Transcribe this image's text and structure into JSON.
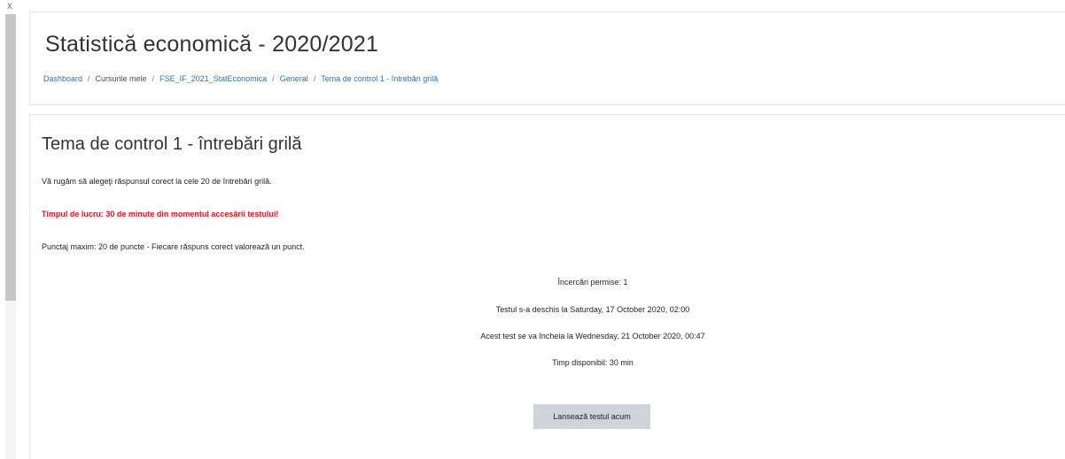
{
  "ui": {
    "collapse_glyph": "x"
  },
  "header": {
    "course_title": "Statistică economică - 2020/2021",
    "breadcrumb": [
      {
        "label": "Dashboard",
        "link": true
      },
      {
        "label": "Cursurile mele",
        "link": false
      },
      {
        "label": "FSE_IF_2021_StatEconomica",
        "link": true
      },
      {
        "label": "General",
        "link": true
      },
      {
        "label": "Tema de control 1 - întrebări grilă",
        "link": true
      }
    ],
    "separator": "/"
  },
  "quiz": {
    "title": "Tema de control 1 - întrebări grilă",
    "intro": [
      "Vă rugăm să alegeţi răspunsul corect la cele 20 de întrebări grilă.",
      "Timpul de lucru: 30 de minute din momentul accesării testului!",
      "Punctaj maxim: 20 de puncte - Fiecare răspuns corect valorează un punct."
    ],
    "info": [
      "Încercări permise: 1",
      "Testul s-a deschis la Saturday, 17 October 2020, 02:00",
      "Acest test se va încheia la Wednesday, 21 October 2020, 00:47",
      "Timp disponibil: 30 min"
    ],
    "start_button_label": "Lansează testul acum"
  },
  "colors": {
    "link": "#2f6fb0",
    "warning": "#e3111d",
    "button_bg": "#ced4da"
  }
}
